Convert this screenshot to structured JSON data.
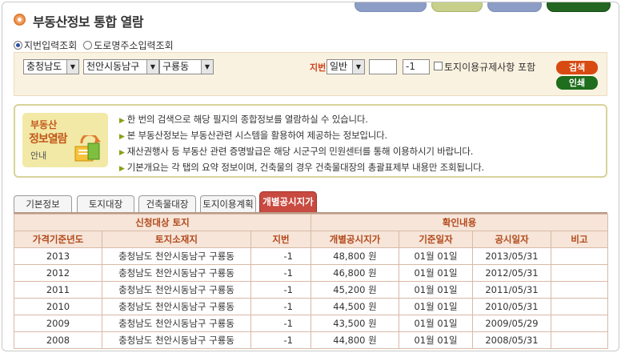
{
  "page_title": "부동산정보 통합 열람",
  "top_buttons": [
    "",
    "",
    "",
    ""
  ],
  "search_mode": {
    "options": [
      "지번입력조회",
      "도로명주소입력조회"
    ],
    "selected": 0
  },
  "search": {
    "sido": "충청남도",
    "sigungu": "천안시동남구",
    "dong": "구룡동",
    "jibun_label": "지번",
    "jibun_type": "일반",
    "bonbun": "",
    "bubun": "-1",
    "include_regulation_label": "토지이용규제사항 포함",
    "search_button": "검색",
    "print_button": "인쇄"
  },
  "info": {
    "badge": [
      "부동산",
      "정보열람",
      "안내"
    ],
    "lines": [
      "한 번의 검색으로 해당 필지의 종합정보를 열람하실 수 있습니다.",
      "본 부동산정보는 부동산관련 시스템을 활용하여 제공하는 정보입니다.",
      "재산권행사 등 부동산 관련 증명발급은 해당 시군구의 민원센터를 통해 이용하시기 바랍니다.",
      "기본개요는 각 탭의 요약 정보이며, 건축물의 경우 건축물대장의 총괄표제부 내용만 조회됩니다."
    ]
  },
  "tabs": [
    "기본정보",
    "토지대장",
    "건축물대장",
    "토지이용계획",
    "개별공시지가"
  ],
  "active_tab": 4,
  "table": {
    "group_headers": [
      "신청대상 토지",
      "확인내용"
    ],
    "columns": [
      "가격기준년도",
      "토지소재지",
      "지번",
      "개별공시지가",
      "기준일자",
      "공시일자",
      "비고"
    ],
    "rows": [
      [
        "2013",
        "충청남도 천안시동남구 구룡동",
        "-1",
        "48,800 원",
        "01월 01일",
        "2013/05/31",
        ""
      ],
      [
        "2012",
        "충청남도 천안시동남구 구룡동",
        "-1",
        "46,800 원",
        "01월 01일",
        "2012/05/31",
        ""
      ],
      [
        "2011",
        "충청남도 천안시동남구 구룡동",
        "-1",
        "45,200 원",
        "01월 01일",
        "2011/05/31",
        ""
      ],
      [
        "2010",
        "충청남도 천안시동남구 구룡동",
        "-1",
        "44,500 원",
        "01월 01일",
        "2010/05/31",
        ""
      ],
      [
        "2009",
        "충청남도 천안시동남구 구룡동",
        "-1",
        "43,500 원",
        "01월 01일",
        "2009/05/29",
        ""
      ],
      [
        "2008",
        "충청남도 천안시동남구 구룡동",
        "-1",
        "44,800 원",
        "01월 01일",
        "2008/05/31",
        ""
      ]
    ]
  },
  "colors": {
    "accent": "#c84a40",
    "header_text": "#b2481a",
    "header_bg": "#f6e5d8",
    "search_btn": "#d84a12",
    "print_btn": "#1e6e1e"
  }
}
